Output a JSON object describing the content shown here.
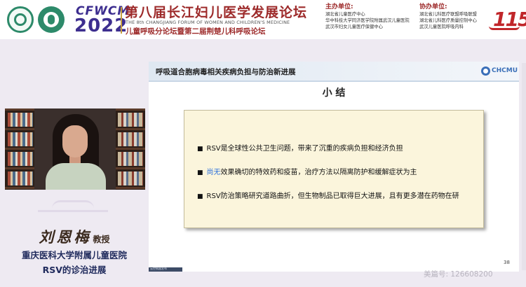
{
  "header": {
    "logo_left_1": "hospital-logo-icon",
    "logo_left_2": "maternal-child-logo-icon",
    "brand_abbr": "CFWCM",
    "year": "2022",
    "title_cn": "第八届长江妇儿医学发展论坛",
    "title_en": "THE 8th CHANGJIANG FORUM OF WOMEN AND CHILDREN'S MEDICINE",
    "subtitle_cn": "儿童呼吸分论坛暨第二届荆楚儿科呼吸论坛",
    "organizers": {
      "head": "主办单位:",
      "items": [
        "湖北省儿童医疗中心",
        "华中科技大学同济医学院附属武汉儿童医院",
        "武汉市妇女儿童医疗保健中心"
      ]
    },
    "co_organizers": {
      "head": "协办单位:",
      "items": [
        "湖北省儿科医疗联盟呼吸联盟",
        "湖北省儿科医疗质量控制中心",
        "武汉儿童医院呼吸内科"
      ]
    },
    "anniversary_badge": "115",
    "colors": {
      "brand_purple": "#3d2e8f",
      "title_red": "#9d2a2a"
    }
  },
  "slide": {
    "title": "呼吸道合胞病毒相关疾病负担与防治新进展",
    "institution_logo": "CHCMU",
    "summary_heading": "小 结",
    "bullets": [
      {
        "dot": "■",
        "pre": "",
        "highlight": "",
        "text": "RSV是全球性公共卫生问题，带来了沉重的疾病负担和经济负担"
      },
      {
        "dot": "■",
        "pre": "",
        "highlight": "尚无",
        "text": "效果确切的特效药和疫苗，治疗方法以隔离防护和缓解症状为主"
      },
      {
        "dot": "■",
        "pre": "",
        "highlight": "",
        "text": "RSV防治策略研究道路曲折，但生物制品已取得巨大进展，且有更多潜在药物在研"
      }
    ],
    "page_number": "38",
    "tag": "云控制器发布"
  },
  "speaker": {
    "name": "刘恩梅",
    "title": "教授",
    "org": "重庆医科大学附属儿童医院",
    "topic": "RSV的诊治进展"
  },
  "watermark": "美篇号: 126608200"
}
